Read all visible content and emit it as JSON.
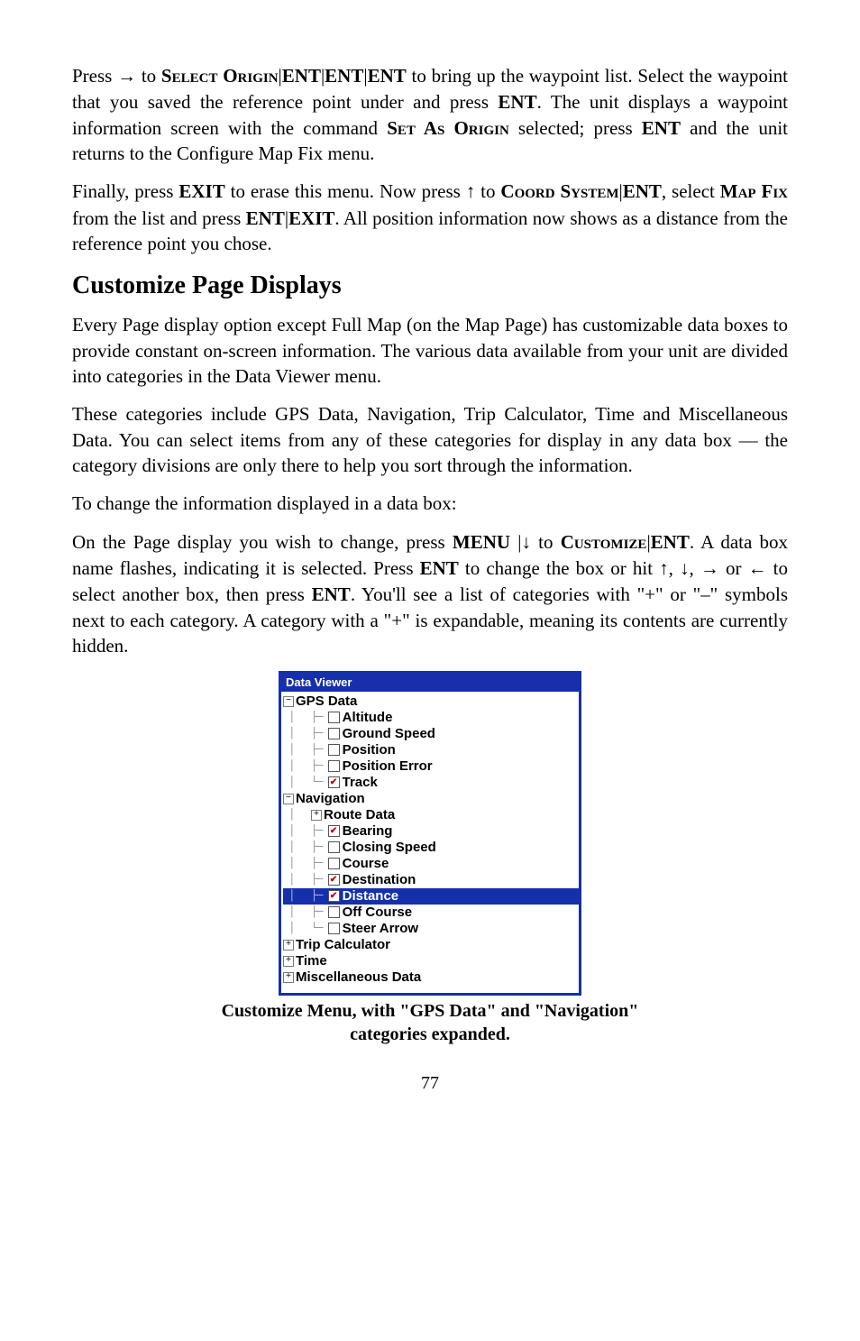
{
  "para1_a": "Press ",
  "para1_arrow": "→",
  "para1_b": " to ",
  "para1_sc1": "Select Origin",
  "para1_c": "|",
  "para1_ent1": "ENT",
  "para1_d": "|",
  "para1_ent2": "ENT",
  "para1_e": "|",
  "para1_ent3": "ENT",
  "para1_f": " to bring up the waypoint list. Select the waypoint that you saved the reference point under and press ",
  "para1_ent4": "ENT",
  "para1_g": ". The unit displays a waypoint information screen with the command ",
  "para1_sc2": "Set As Origin",
  "para1_h": " selected; press ",
  "para1_ent5": "ENT",
  "para1_i": " and the unit returns to the Configure Map Fix menu.",
  "para2_a": "Finally, press ",
  "para2_exit1": "EXIT",
  "para2_b": " to erase this menu. Now press ",
  "para2_up": "↑",
  "para2_c": " to ",
  "para2_sc1": "Coord System",
  "para2_d": "|",
  "para2_ent1": "ENT",
  "para2_e": ", select ",
  "para2_sc2": "Map Fix",
  "para2_f": " from the list and press ",
  "para2_ent2": "ENT",
  "para2_g": "|",
  "para2_exit2": "EXIT",
  "para2_h": ". All position information now shows as a distance from the reference point you chose.",
  "heading": "Customize Page Displays",
  "para3": "Every Page display option except Full Map (on the Map Page) has customizable data boxes to provide constant on-screen information. The various data available from your unit are divided into categories in the Data Viewer menu.",
  "para4": "These categories include GPS Data, Navigation, Trip Calculator, Time and Miscellaneous Data. You can select items from any of these categories for display in any data box — the category divisions are only there to help you sort through the information.",
  "para5": "To change the information displayed in a data box:",
  "para6_a": "On the Page display you wish to change, press ",
  "para6_menu": "MENU",
  "para6_b": " |",
  "para6_down": "↓",
  "para6_c": " to ",
  "para6_sc1": "Customize",
  "para6_d": "|",
  "para6_ent1": "ENT",
  "para6_e": ". A data box name flashes, indicating it is selected. Press ",
  "para6_ent2": "ENT",
  "para6_f": " to change the box or hit ",
  "para6_up": "↑",
  "para6_g": ", ",
  "para6_down2": "↓",
  "para6_h": ", ",
  "para6_right": "→",
  "para6_i": " or ",
  "para6_left": "←",
  "para6_j": " to select another box, then press ",
  "para6_ent3": "ENT",
  "para6_k": ". You'll see a list of categories with \"+\" or \"–\" symbols next to each category. A category with a \"+\" is expandable, meaning its contents are currently hidden.",
  "viewer_title": "Data Viewer",
  "tree": {
    "gps": {
      "label": "GPS Data",
      "expanded": true,
      "items": [
        {
          "label": "Altitude",
          "checked": false
        },
        {
          "label": "Ground Speed",
          "checked": false
        },
        {
          "label": "Position",
          "checked": false
        },
        {
          "label": "Position Error",
          "checked": false
        },
        {
          "label": "Track",
          "checked": true
        }
      ]
    },
    "nav": {
      "label": "Navigation",
      "expanded": true,
      "items": [
        {
          "label": "Route Data",
          "expandable": true
        },
        {
          "label": "Bearing",
          "checked": true
        },
        {
          "label": "Closing Speed",
          "checked": false
        },
        {
          "label": "Course",
          "checked": false
        },
        {
          "label": "Destination",
          "checked": true
        },
        {
          "label": "Distance",
          "checked": true,
          "selected": true
        },
        {
          "label": "Off Course",
          "checked": false
        },
        {
          "label": "Steer Arrow",
          "checked": false
        }
      ]
    },
    "trip": {
      "label": "Trip Calculator",
      "expanded": false
    },
    "time": {
      "label": "Time",
      "expanded": false
    },
    "misc": {
      "label": "Miscellaneous Data",
      "expanded": false
    }
  },
  "caption_a": "Customize Menu, with \"GPS Data\" and \"Navigation\"",
  "caption_b": "categories expanded.",
  "page": "77"
}
